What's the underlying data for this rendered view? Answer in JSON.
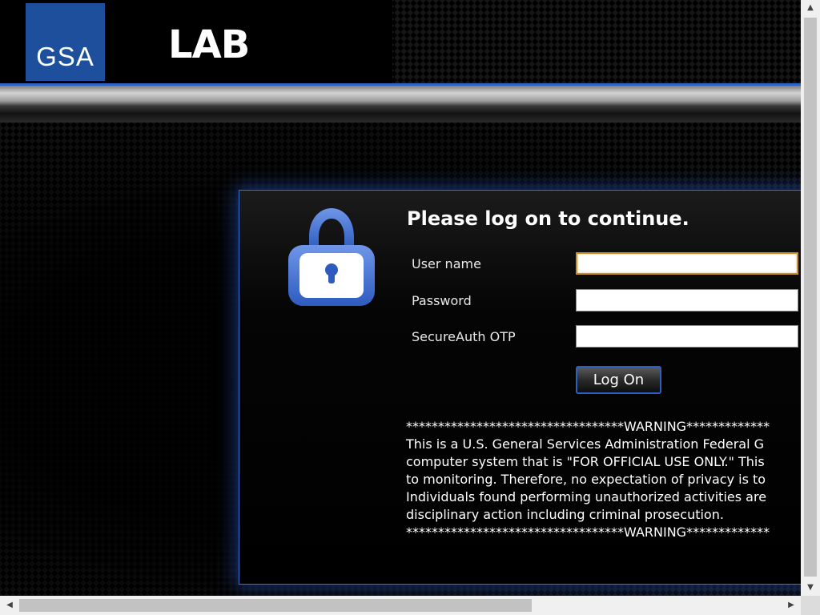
{
  "header": {
    "logo_text": "GSA",
    "site_title": "LAB"
  },
  "login": {
    "heading": "Please log on to continue.",
    "username_label": "User name",
    "username_value": "",
    "password_label": "Password",
    "password_value": "",
    "otp_label": "SecureAuth OTP",
    "otp_value": "",
    "submit_label": "Log On"
  },
  "warning": {
    "top_banner": "**********************************WARNING*************",
    "line1": "This is a U.S. General Services Administration Federal G",
    "line2": "computer system that is \"FOR OFFICIAL USE ONLY.\" This",
    "line3": "to monitoring. Therefore, no expectation of privacy is to",
    "line4": "Individuals found performing unauthorized activities are",
    "line5": "disciplinary action including criminal prosecution.",
    "bottom_banner": "**********************************WARNING*************"
  },
  "icons": {
    "lock": "padlock-icon"
  },
  "colors": {
    "accent_blue": "#2a62c9",
    "logo_blue": "#1d4f9c",
    "focus_border": "#c8902a"
  }
}
